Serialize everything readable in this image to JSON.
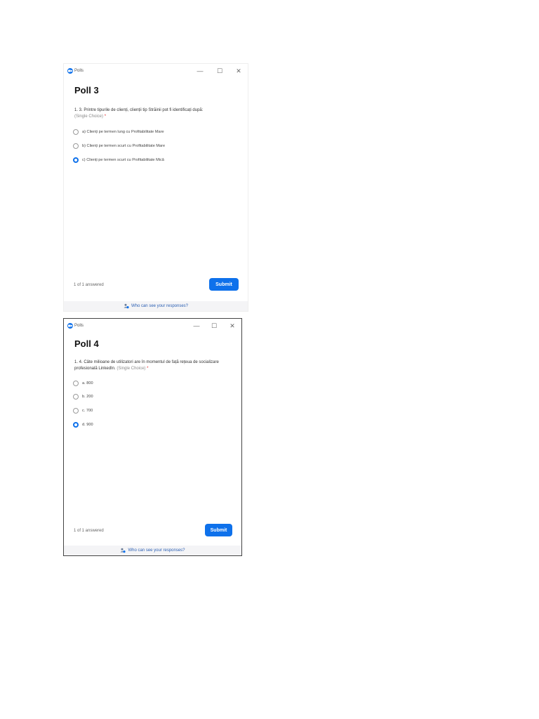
{
  "windows": [
    {
      "app_name": "Polls",
      "controls": {
        "minimize": "—",
        "maximize": "☐",
        "close": "✕"
      },
      "poll_title": "Poll 3",
      "question_text": "1. 3. Printre tipurile de clienți, clienții tip Străinii pot fi identificați după:",
      "question_type": "(Single Choice)",
      "required_mark": "*",
      "options": [
        {
          "label": "a) Clienți pe termen lung cu Profitabilitate Mare",
          "selected": false
        },
        {
          "label": "b) Clienți pe termen scurt cu Profitabilitate Mare",
          "selected": false
        },
        {
          "label": "c) Clienți pe termen scurt cu Profitabilitate Mică",
          "selected": true
        }
      ],
      "answered": "1 of 1 answered",
      "submit_label": "Submit",
      "footer_link": "Who can see your responses?"
    },
    {
      "app_name": "Polls",
      "controls": {
        "minimize": "—",
        "maximize": "☐",
        "close": "✕"
      },
      "poll_title": "Poll 4",
      "question_text": "1. 4. Câte milioane de utilizatori are în momentul de față rețeua de socializare profesională LinkedIn.",
      "question_type": "(Single Choice)",
      "required_mark": "*",
      "options": [
        {
          "label": "a. 800",
          "selected": false
        },
        {
          "label": "b. 200",
          "selected": false
        },
        {
          "label": "c. 700",
          "selected": false
        },
        {
          "label": "d. 900",
          "selected": true
        }
      ],
      "answered": "1 of 1 answered",
      "submit_label": "Submit",
      "footer_link": "Who can see your responses?"
    }
  ],
  "colors": {
    "accent": "#0e71eb",
    "footer_bg": "#f4f4f6",
    "link": "#2b5fb3",
    "required": "#e02828"
  }
}
